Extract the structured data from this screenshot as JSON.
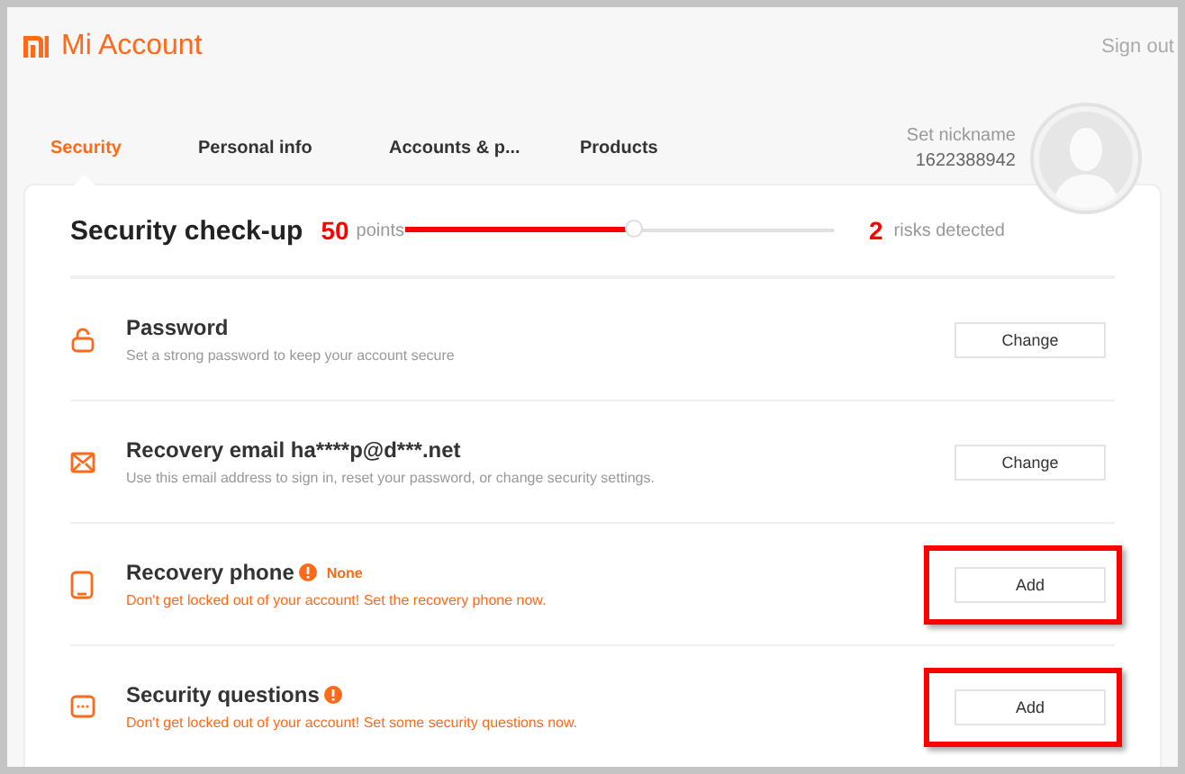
{
  "header": {
    "logo": "Mi Account",
    "sign_out": "Sign out"
  },
  "tabs": [
    {
      "label": "Security",
      "selected": true
    },
    {
      "label": "Personal info",
      "selected": false
    },
    {
      "label": "Accounts & p...",
      "selected": false
    },
    {
      "label": "Products",
      "selected": false
    }
  ],
  "profile": {
    "nickname": "Set nickname",
    "id": "1622388942"
  },
  "checkup": {
    "title": "Security check-up",
    "score": "50",
    "score_unit": "points",
    "level": 0.53,
    "risks": "2",
    "risks_label": "risks detected"
  },
  "items": [
    {
      "kind": "lock",
      "title": "Password",
      "warning": false,
      "description": "Set a strong password to keep your account secure",
      "button": "Change",
      "highlighted": false
    },
    {
      "kind": "mail",
      "title": "Recovery email ha****p@d***.net",
      "warning": false,
      "description": "Use this email address to sign in, reset your password, or change security settings.",
      "button": "Change",
      "highlighted": false
    },
    {
      "kind": "phone",
      "title": "Recovery phone",
      "warning": true,
      "status": "None",
      "description": "Don't get locked out of your account! Set the recovery phone now.",
      "button": "Add",
      "highlighted": true
    },
    {
      "kind": "dots",
      "title": "Security questions",
      "warning": true,
      "description": "Don't get locked out of your account! Set some security questions now.",
      "button": "Add",
      "highlighted": true
    }
  ]
}
